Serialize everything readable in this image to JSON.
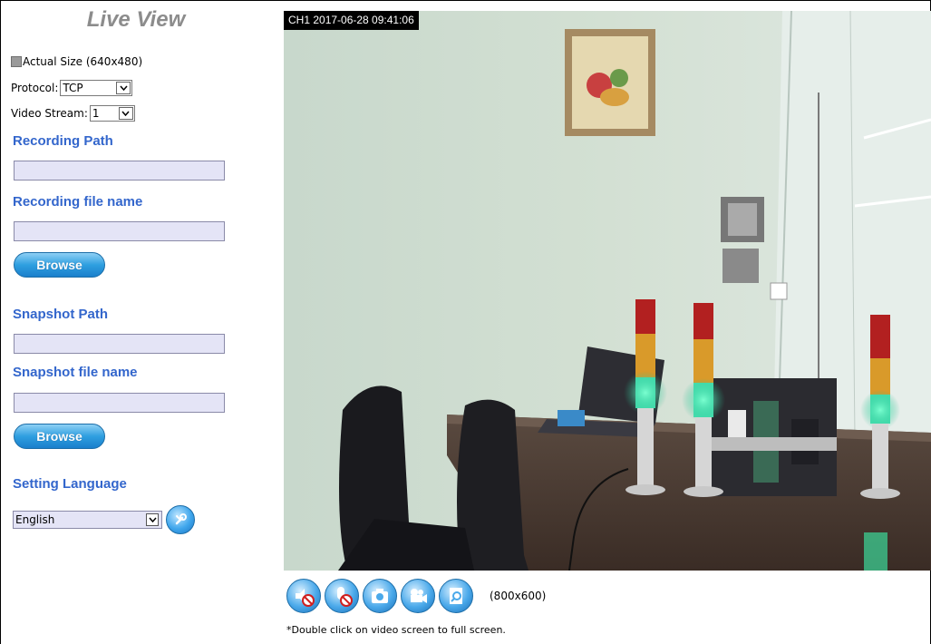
{
  "panel": {
    "title": "Live View",
    "actual_size_label": "Actual Size (640x480)",
    "protocol_label": "Protocol:",
    "protocol_value": "TCP",
    "video_stream_label": "Video Stream:",
    "video_stream_value": "1",
    "recording_path_label": "Recording Path",
    "recording_path_value": "",
    "recording_file_label": "Recording file name",
    "recording_file_value": "",
    "browse_label_1": "Browse",
    "snapshot_path_label": "Snapshot Path",
    "snapshot_path_value": "",
    "snapshot_file_label": "Snapshot file name",
    "snapshot_file_value": "",
    "browse_label_2": "Browse",
    "language_label": "Setting Language",
    "language_value": "English"
  },
  "video": {
    "timestamp": "CH1 2017-06-28 09:41:06",
    "resolution": "(800x600)",
    "note": "*Double click on video screen to full screen."
  },
  "colors": {
    "section_blue": "#3366cc",
    "title_gray": "#8c8c8c",
    "button_blue": "#2f9fe0"
  }
}
